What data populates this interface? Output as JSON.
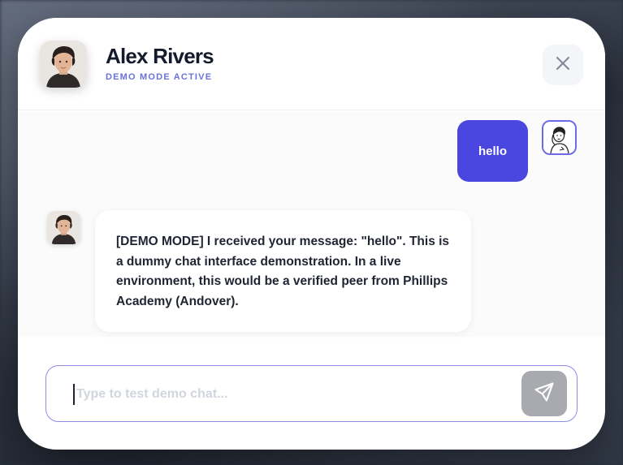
{
  "header": {
    "name": "Alex Rivers",
    "status": "DEMO MODE ACTIVE"
  },
  "icons": {
    "close": "close-icon",
    "send": "send-icon",
    "contact_avatar": "contact-avatar",
    "user_avatar": "user-avatar"
  },
  "messages": [
    {
      "sender": "user",
      "text": "hello"
    },
    {
      "sender": "contact",
      "text": "[DEMO MODE] I received your message: \"hello\". This is a dummy chat interface demonstration. In a live environment, this would be a verified peer from Phillips Academy (Andover)."
    }
  ],
  "composer": {
    "placeholder": "Type to test demo chat...",
    "value": ""
  },
  "colors": {
    "accent": "#4a46e0",
    "status": "#6a73d8",
    "input_border": "#8f8ce8",
    "send_disabled": "#a8aab0"
  }
}
